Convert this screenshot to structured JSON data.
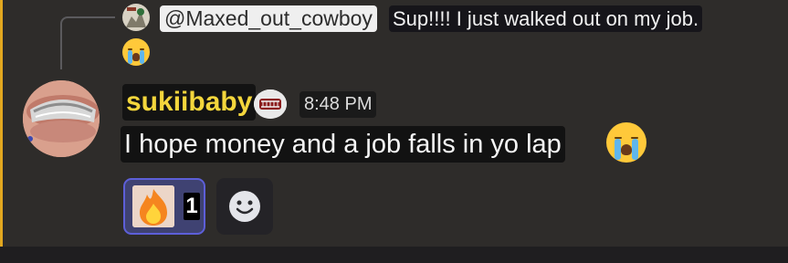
{
  "reply": {
    "mention": "@Maxed_out_cowboy",
    "text": "Sup!!!! I just walked out on my job.",
    "emoji": "loudly-crying-face"
  },
  "message": {
    "author": "sukiibaby",
    "timestamp": "8:48 PM",
    "text": "I hope money and a job falls in yo lap",
    "emoji": "loudly-crying-face"
  },
  "reactions": [
    {
      "emoji": "fire",
      "count": "1"
    }
  ],
  "colors": {
    "background": "#2e2c2a",
    "accent_bar": "#e2a720",
    "username": "#f4d63c",
    "reaction_border": "#5d5fd8",
    "reaction_bg": "#3f4272"
  }
}
